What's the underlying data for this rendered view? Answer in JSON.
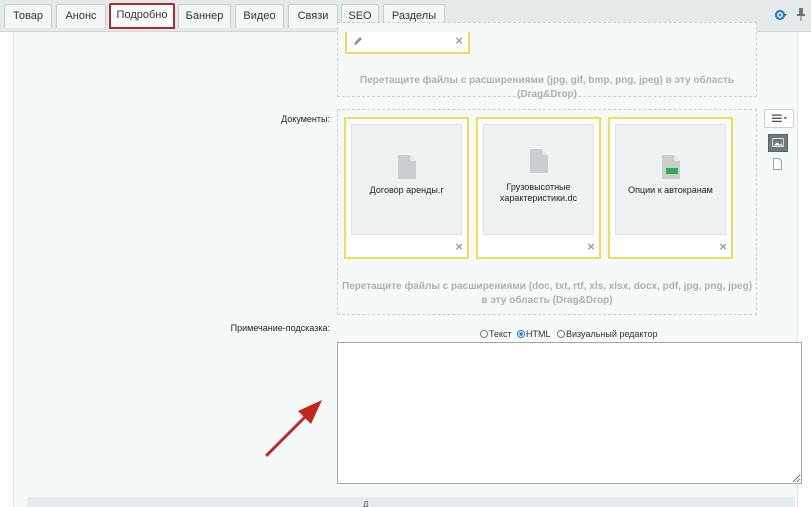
{
  "tabs": [
    {
      "label": "Товар",
      "active": false
    },
    {
      "label": "Анонс",
      "active": false
    },
    {
      "label": "Подробно",
      "active": true
    },
    {
      "label": "Баннер",
      "active": false
    },
    {
      "label": "Видео",
      "active": false
    },
    {
      "label": "Связи",
      "active": false
    },
    {
      "label": "SEO",
      "active": false
    },
    {
      "label": "Разделы",
      "active": false
    }
  ],
  "images_zone": {
    "hint": "Перетащите файлы с расширениями (jpg, gif, bmp, png, jpeg) в эту область (Drag&Drop)"
  },
  "documents": {
    "label": "Документы:",
    "files": [
      {
        "name": "Договор аренды.r",
        "type": "doc"
      },
      {
        "name": "Грузовысотные характеристики.dc",
        "type": "doc"
      },
      {
        "name": "Опции к автокранам",
        "type": "xls"
      }
    ],
    "hint": "Перетащите файлы с расширениями (doc, txt, rtf, xls, xlsx, docx, pdf, jpg, png, jpeg) в эту область (Drag&Drop)",
    "delete_symbol": "×"
  },
  "note": {
    "label": "Примечание-подсказка:",
    "modes": [
      {
        "label": "Текст",
        "selected": false
      },
      {
        "label": "HTML",
        "selected": true
      },
      {
        "label": "Визуальный редактор",
        "selected": false
      }
    ],
    "value": ""
  },
  "bottom_bar": {
    "label": "Д"
  },
  "colors": {
    "accent": "#b22a24",
    "file_card_border": "#f1db58",
    "arrow": "#c0281e",
    "xls_badge": "#3aa54a"
  }
}
